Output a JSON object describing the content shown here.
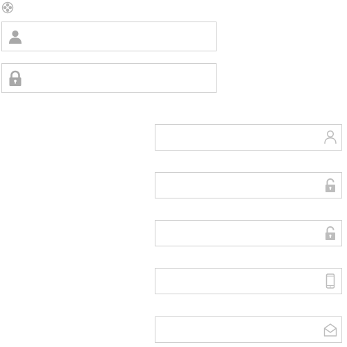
{
  "form": {
    "move_icon": "move-icon",
    "login": {
      "username": {
        "placeholder": "",
        "value": "",
        "icon": "user-icon"
      },
      "password": {
        "placeholder": "",
        "value": "",
        "icon": "lock-icon"
      }
    },
    "register": {
      "username": {
        "placeholder": "",
        "value": "",
        "icon": "user-outline-icon"
      },
      "password": {
        "placeholder": "",
        "value": "",
        "icon": "unlock-icon"
      },
      "confirm_password": {
        "placeholder": "",
        "value": "",
        "icon": "unlock-icon"
      },
      "phone": {
        "placeholder": "",
        "value": "",
        "icon": "phone-icon"
      },
      "email": {
        "placeholder": "",
        "value": "",
        "icon": "envelope-icon"
      }
    }
  },
  "colors": {
    "border": "#cfcfcf",
    "icon_dark": "#a8a8a8",
    "icon_light": "#bdbdbd"
  }
}
